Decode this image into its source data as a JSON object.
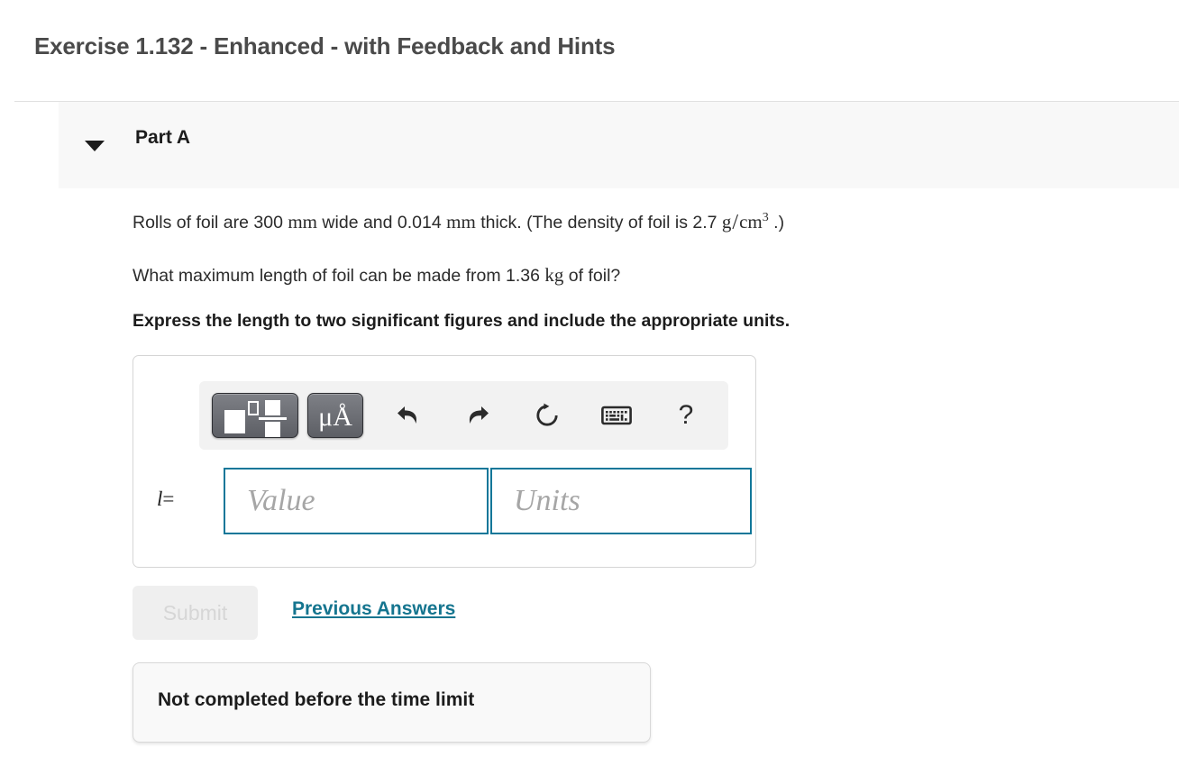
{
  "header": {
    "exercise_title": "Exercise 1.132 - Enhanced - with Feedback and Hints"
  },
  "part": {
    "label": "Part A",
    "toggle_icon": "caret-down-icon",
    "expanded": true,
    "band_background": "#f8f8f8"
  },
  "question": {
    "line1": {
      "pre": "Rolls of foil are 300 ",
      "unit1": "mm",
      "mid1": " wide and 0.014 ",
      "unit2": "mm",
      "mid2": " thick. (The density of foil is 2.7 ",
      "unit3_num": "g",
      "unit3_slash": "/",
      "unit3_den": "cm",
      "unit3_exp": "3",
      "post": " .)"
    },
    "line2": {
      "pre": "What maximum length of foil can be made from 1.36 ",
      "unit": "kg",
      "post": " of foil?"
    },
    "instruction": "Express the length to two significant figures and include the appropriate units."
  },
  "answer": {
    "toolbar": {
      "template_button": {
        "name": "math-template-button",
        "tooltip": "Template"
      },
      "units_button": {
        "name": "units-button",
        "label_mu": "μ",
        "label_angstrom": "Å"
      },
      "undo_button": {
        "name": "undo-icon"
      },
      "redo_button": {
        "name": "redo-icon"
      },
      "reset_button": {
        "name": "reset-icon"
      },
      "keyboard_button": {
        "name": "keyboard-icon"
      },
      "help_button": {
        "name": "help-icon",
        "label": "?"
      }
    },
    "variable_label": "l",
    "equals_sign": "=",
    "value_field": {
      "placeholder": "Value",
      "value": ""
    },
    "units_field": {
      "placeholder": "Units",
      "value": ""
    },
    "border_color": "#117799"
  },
  "actions": {
    "submit_label": "Submit",
    "submit_enabled": false,
    "previous_answers_label": "Previous Answers",
    "link_color": "#15758f"
  },
  "status": {
    "message": "Not completed before the time limit"
  }
}
